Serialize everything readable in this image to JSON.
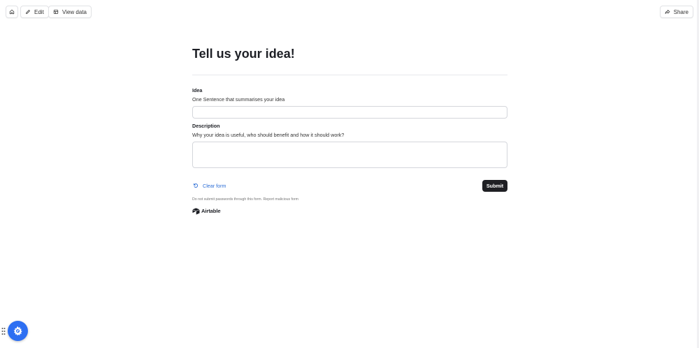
{
  "toolbar": {
    "home_icon": "home-icon",
    "edit_label": "Edit",
    "edit_icon": "pencil-icon",
    "view_data_label": "View data",
    "view_data_icon": "table-icon",
    "share_label": "Share",
    "share_icon": "share-icon"
  },
  "form": {
    "title": "Tell us your idea!",
    "fields": [
      {
        "label": "Idea",
        "description": "One Sentence that summarises your idea",
        "value": ""
      },
      {
        "label": "Description",
        "description": "Why your idea is useful, who should benefit and how it should work?",
        "value": ""
      }
    ],
    "clear_label": "Clear form",
    "clear_icon": "reset-icon",
    "submit_label": "Submit",
    "footnote": "Do not submit passwords through this form.",
    "report_link": "Report malicious form",
    "brand": "Airtable"
  },
  "widget": {
    "drag_icon": "drag-handle-icon",
    "fab_icon": "rocket-gear-icon"
  },
  "colors": {
    "accent": "#2d6ed6",
    "submit_bg": "#1f2024",
    "fab_bg": "#2d6ff2"
  }
}
